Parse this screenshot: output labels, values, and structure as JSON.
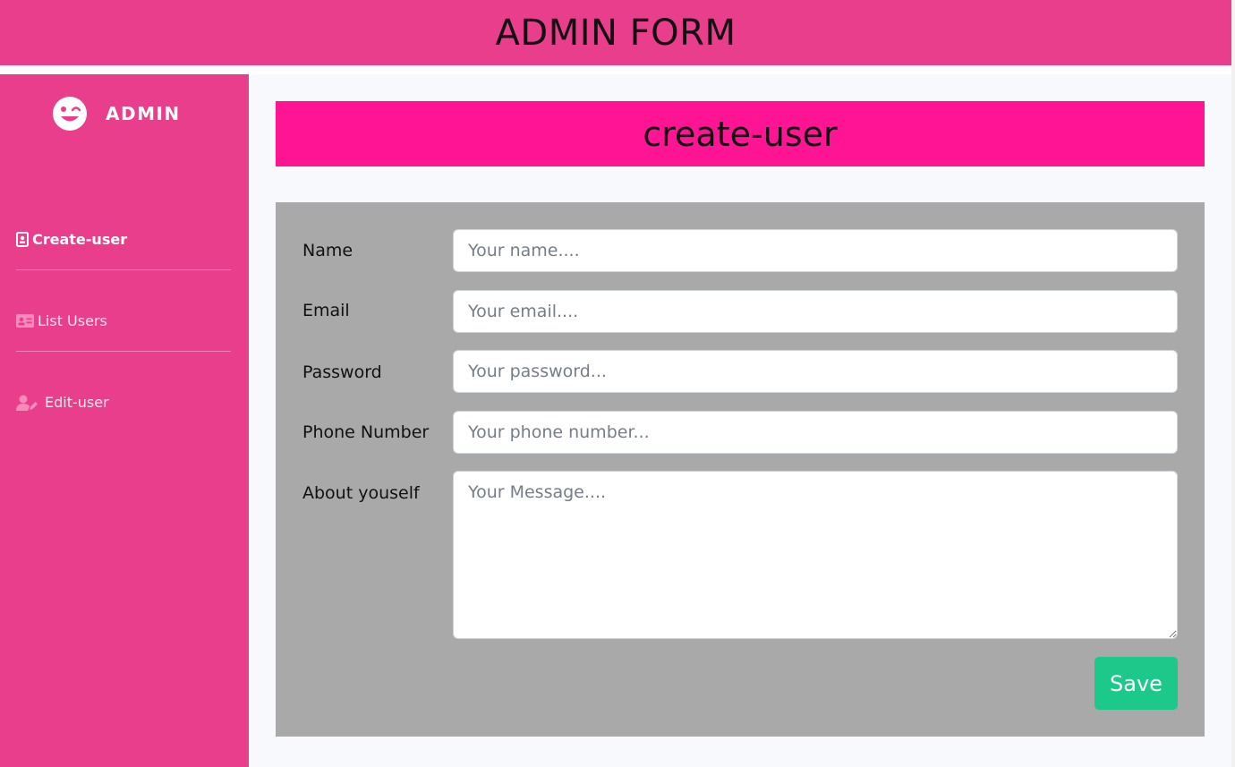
{
  "header": {
    "title": "ADMIN FORM"
  },
  "sidebar": {
    "brand": {
      "label": "ADMIN",
      "icon": "grin-wink-icon"
    },
    "items": [
      {
        "label": "Create-user",
        "icon": "id-badge-icon",
        "active": true
      },
      {
        "label": "List Users",
        "icon": "id-card-icon",
        "active": false
      },
      {
        "label": "Edit-user",
        "icon": "user-edit-icon",
        "active": false
      }
    ]
  },
  "main": {
    "title": "create-user",
    "form": {
      "name": {
        "label": "Name",
        "placeholder": "Your name...."
      },
      "email": {
        "label": "Email",
        "placeholder": "Your email...."
      },
      "password": {
        "label": "Password",
        "placeholder": "Your password..."
      },
      "phone": {
        "label": "Phone Number",
        "placeholder": "Your phone number..."
      },
      "about": {
        "label": "About youself",
        "placeholder": "Your Message...."
      },
      "save_label": "Save"
    }
  },
  "colors": {
    "header_bg": "#e83e8c",
    "sidebar_bg": "#e83e8c",
    "banner_bg": "#ff1493",
    "form_bg": "#a9a9a9",
    "save_bg": "#1cc88a"
  }
}
